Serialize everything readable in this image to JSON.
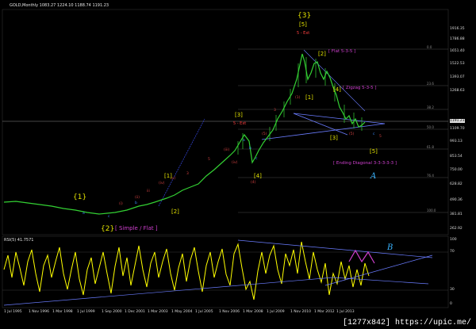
{
  "chart": {
    "main_title": "GOLD,Monthly  1083.27 1224.10 1188.74 1191.23",
    "ind_title": "RSI(5) 41.7571",
    "price_scale": [
      "1916.35",
      "1786.88",
      "1651.40",
      "1522.53",
      "1393.07",
      "1268.63",
      "1191.23",
      "1109.70",
      "993.13",
      "853.54",
      "750.00",
      "628.82",
      "490.36",
      "381.81",
      "262.92"
    ],
    "rsi_scale": [
      "100",
      "70",
      "30",
      "0"
    ],
    "dates": [
      "1 Jul 1995",
      "1 Nov 1996",
      "1 Mar 1998",
      "1 Jul 1999",
      "1 Sep 2000",
      "1 Dec 2001",
      "1 Mar 2003",
      "1 May 2004",
      "1 Jul 2005",
      "1 Nov 2006",
      "1 Mar 2008",
      "1 Jul 2009",
      "1 Nov 2010",
      "1 Mar 2012",
      "1 Jul 2013"
    ],
    "fib_labels": [
      "0.0",
      "23.6",
      "38.2",
      "50.0",
      "61.8",
      "76.4",
      "100.0"
    ]
  },
  "annotations": {
    "wave3_top": "{3}",
    "wave3_sub": "[5]",
    "wave3_note": "5 - Ext",
    "wave2": "[2]",
    "flat_note": "[ Flat 5-3-5 ]",
    "zigzag_note": "[ Zigzag 5-3-5 ]",
    "wave4_upper": "[4]",
    "wave1_low": "[1]",
    "wave3_low": "[3]",
    "wave5": "[5]",
    "ending_diag": "[ Ending Diagonal 3-3-3-3-3 ]",
    "mark_a": "A",
    "mark_b": "B",
    "wave1_big": "{1}",
    "wave2_big": "{2}",
    "simple_flat": "[ Simple / Flat ]",
    "bracket3_left": "[3]",
    "bracket3_ext": "5 - Ext",
    "bracket1": "[1]",
    "bracket2": "[2]",
    "bracket4": "[4]",
    "wave_a": "a",
    "wave_b": "b",
    "wave_c": "c"
  },
  "watermark": "[1277x842] https://upic.me/"
}
